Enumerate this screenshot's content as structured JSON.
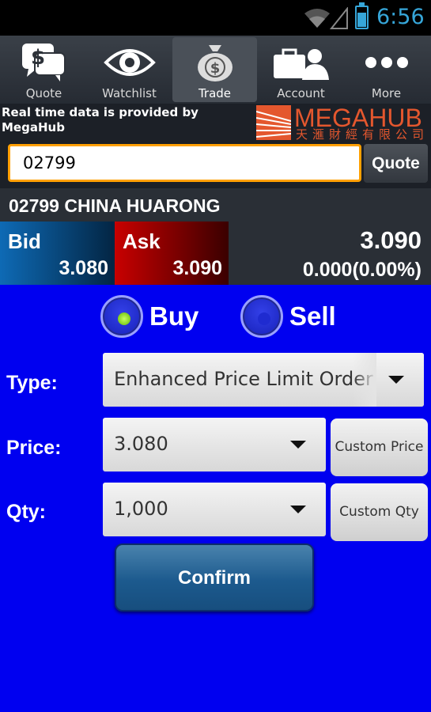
{
  "status_bar": {
    "time": "6:56",
    "icons": [
      "wifi-icon",
      "signal-icon",
      "battery-icon"
    ]
  },
  "tabs": [
    {
      "label": "Quote",
      "icon": "quote-speech-icon",
      "active": false
    },
    {
      "label": "Watchlist",
      "icon": "eye-icon",
      "active": false
    },
    {
      "label": "Trade",
      "icon": "money-bag-icon",
      "active": true
    },
    {
      "label": "Account",
      "icon": "account-briefcase-icon",
      "active": false
    },
    {
      "label": "More",
      "icon": "more-dots-icon",
      "active": false
    }
  ],
  "provider": {
    "text": "Real time data is provided by MegaHub",
    "logo_en": "MEGAHUB",
    "logo_cn": "天滙財經有限公司"
  },
  "search": {
    "value": "02799",
    "button_label": "Quote"
  },
  "stock": {
    "title": "02799 CHINA HUARONG",
    "bid_label": "Bid",
    "bid_value": "3.080",
    "ask_label": "Ask",
    "ask_value": "3.090",
    "last_price": "3.090",
    "change": "0.000(0.00%)"
  },
  "order": {
    "buy_label": "Buy",
    "sell_label": "Sell",
    "side_selected": "Buy",
    "type_label": "Type:",
    "type_value": "Enhanced Price Limit Order",
    "price_label": "Price:",
    "price_value": "3.080",
    "custom_price_label": "Custom Price",
    "qty_label": "Qty:",
    "qty_value": "1,000",
    "custom_qty_label": "Custom Qty",
    "confirm_label": "Confirm"
  },
  "colors": {
    "background": "#0000f0",
    "accent": "#ffa000",
    "bid": "#0e6ab5",
    "ask": "#c80000"
  }
}
